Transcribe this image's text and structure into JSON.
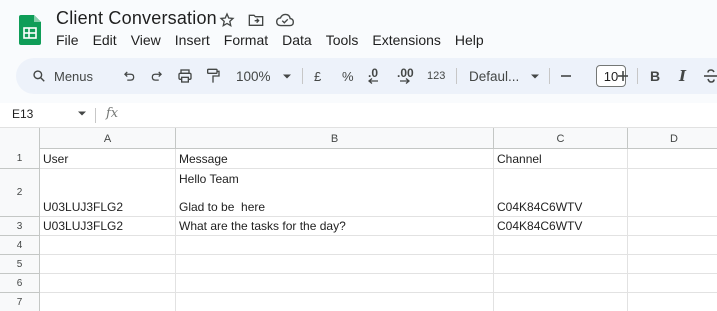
{
  "doc": {
    "title": "Client  Conversation"
  },
  "menu": [
    "File",
    "Edit",
    "View",
    "Insert",
    "Format",
    "Data",
    "Tools",
    "Extensions",
    "Help"
  ],
  "toolbar": {
    "menus_label": "Menus",
    "zoom": "100%",
    "currency": "£",
    "percent": "%",
    "decrease_decimal": ".0",
    "increase_decimal": ".00",
    "number_format": "123",
    "font": "Defaul...",
    "font_size": "10",
    "bold": "B",
    "italic": "I"
  },
  "formula_bar": {
    "cell_ref": "E13",
    "fx": "fx"
  },
  "grid": {
    "columns": [
      "A",
      "B",
      "C",
      "D"
    ],
    "row_numbers": [
      "1",
      "2",
      "3",
      "4",
      "5",
      "6",
      "7"
    ],
    "rows": [
      {
        "a": "User",
        "b": "Message",
        "c": "Channel"
      },
      {
        "a": "U03LUJ3FLG2",
        "b_line1": "Hello Team",
        "b_line2": "Glad to be  here",
        "c": "C04K84C6WTV"
      },
      {
        "a": "U03LUJ3FLG2",
        "b": "What are the tasks for the day?",
        "c": "C04K84C6WTV"
      }
    ]
  },
  "colors": {
    "sheets_green": "#0f9d58",
    "toolbar_bg": "#edf2fa",
    "page_bg": "#f9fbfd",
    "grid_line": "#e2e2e2",
    "header_bg": "#f8f9fa"
  }
}
